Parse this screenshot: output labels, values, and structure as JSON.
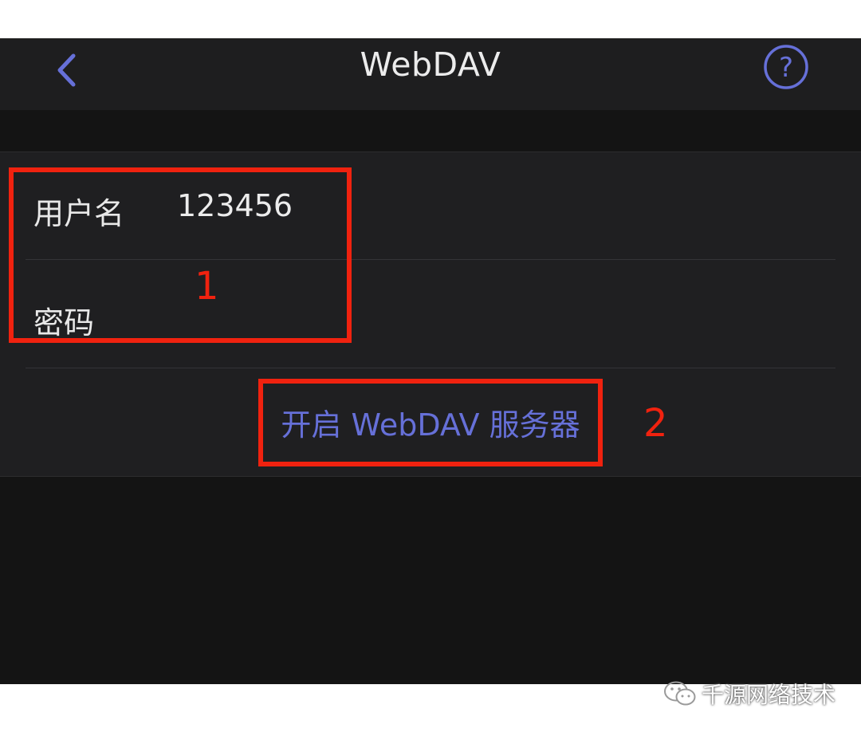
{
  "nav": {
    "title": "WebDAV",
    "back_icon": "chevron-left-icon",
    "help_icon": "question-circle-icon"
  },
  "form": {
    "username_label": "用户名",
    "username_value": "123456",
    "password_label": "密码",
    "password_value": ""
  },
  "actions": {
    "start_server_label": "开启 WebDAV 服务器"
  },
  "annotations": {
    "marker_1": "1",
    "marker_2": "2"
  },
  "watermark": {
    "text": "千源网络技术",
    "icon": "wechat-icon"
  },
  "colors": {
    "accent": "#6670d8",
    "annotation": "#f0220f",
    "background": "#141414",
    "cell": "#1f1f21"
  }
}
